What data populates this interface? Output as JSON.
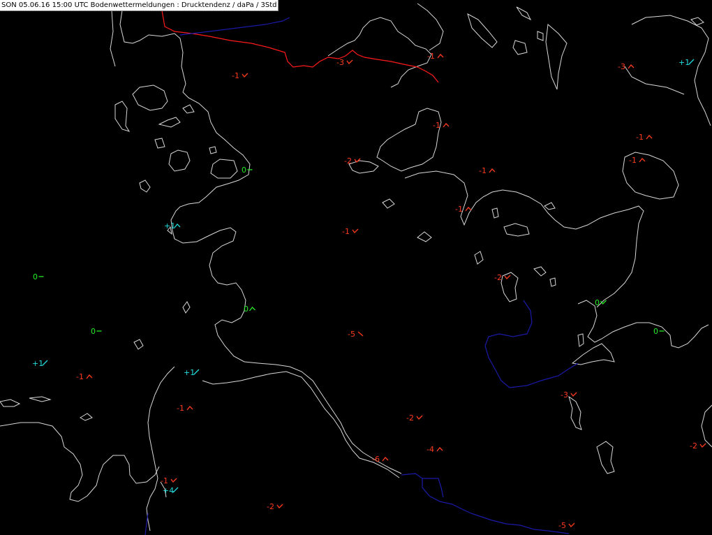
{
  "header": {
    "title": "SON 05.06.16 15:00 UTC  Bodenwettermeldungen :  Drucktendenz / daPa / 3Std"
  },
  "colors": {
    "background": "#000000",
    "falling": "#ff3b1e",
    "steady": "#22ee22",
    "rising": "#22dddd",
    "coastline": "#d8d8d8",
    "border": "#ff1a1a",
    "river": "#1a1aa8"
  },
  "observations": [
    {
      "value": "-1",
      "trend": "falling-rising"
    },
    {
      "value": "-3",
      "trend": "falling-rising"
    },
    {
      "value": "-1",
      "trend": "rising-falling"
    },
    {
      "value": "-3",
      "trend": "rising-falling"
    },
    {
      "value": "+1",
      "trend": "rising"
    },
    {
      "value": "-1",
      "trend": "rising-falling"
    },
    {
      "value": "-1",
      "trend": "rising-falling"
    },
    {
      "value": "-2",
      "trend": "falling-rising"
    },
    {
      "value": "-1",
      "trend": "rising-falling"
    },
    {
      "value": "-1",
      "trend": "rising-falling"
    },
    {
      "value": "0",
      "trend": "steady"
    },
    {
      "value": "-1",
      "trend": "rising-falling"
    },
    {
      "value": "+1",
      "trend": "rising-falling"
    },
    {
      "value": "-1",
      "trend": "falling-rising"
    },
    {
      "value": "0",
      "trend": "steady"
    },
    {
      "value": "-2",
      "trend": "falling-rising"
    },
    {
      "value": "0",
      "trend": "rising-falling"
    },
    {
      "value": "0",
      "trend": "falling-rising"
    },
    {
      "value": "0",
      "trend": "steady"
    },
    {
      "value": "-5",
      "trend": "falling"
    },
    {
      "value": "0",
      "trend": "steady"
    },
    {
      "value": "+1",
      "trend": "rising"
    },
    {
      "value": "+1",
      "trend": "rising"
    },
    {
      "value": "-1",
      "trend": "rising-falling"
    },
    {
      "value": "-3",
      "trend": "falling-rising"
    },
    {
      "value": "-1",
      "trend": "rising-falling"
    },
    {
      "value": "-2",
      "trend": "falling-rising"
    },
    {
      "value": "-4",
      "trend": "rising-falling"
    },
    {
      "value": "-6",
      "trend": "rising-falling"
    },
    {
      "value": "-2",
      "trend": "falling-rising"
    },
    {
      "value": "-1",
      "trend": "falling-rising"
    },
    {
      "value": "+4",
      "trend": "rising"
    },
    {
      "value": "-2",
      "trend": "falling-rising"
    },
    {
      "value": "-5",
      "trend": "falling-rising"
    }
  ]
}
